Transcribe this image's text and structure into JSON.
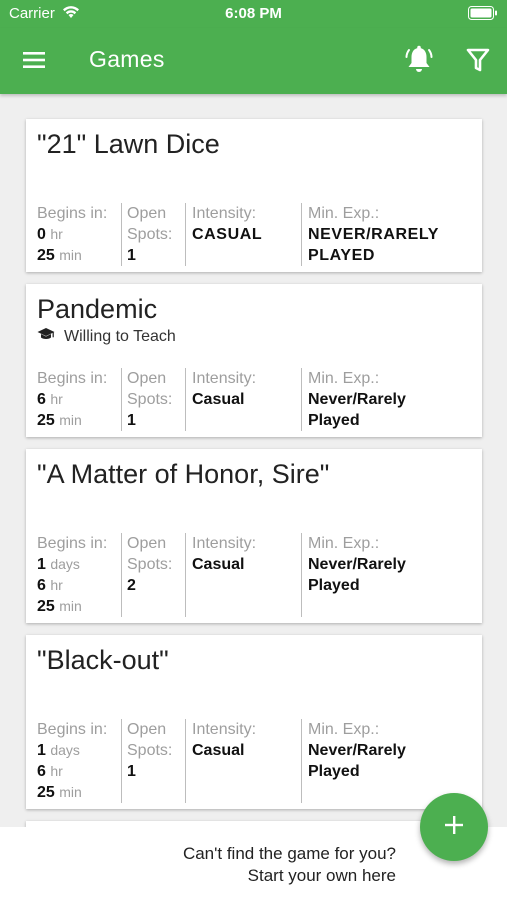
{
  "status_bar": {
    "carrier": "Carrier",
    "time": "6:08 PM"
  },
  "app_bar": {
    "title": "Games"
  },
  "games": [
    {
      "title": "\"21\" Lawn Dice",
      "teach_label": "",
      "begins_label": "Begins in:",
      "begins": [
        {
          "value": "0",
          "unit": "hr"
        },
        {
          "value": "25",
          "unit": "min"
        }
      ],
      "spots_label_1": "Open",
      "spots_label_2": "Spots:",
      "open_spots": "1",
      "intensity_label": "Intensity:",
      "intensity": "CASUAL",
      "exp_label": "Min. Exp.:",
      "exp_line1": "NEVER/RARELY",
      "exp_line2": "PLAYED"
    },
    {
      "title": "Pandemic",
      "teach_label": "Willing to Teach",
      "begins_label": "Begins in:",
      "begins": [
        {
          "value": "6",
          "unit": "hr"
        },
        {
          "value": "25",
          "unit": "min"
        }
      ],
      "spots_label_1": "Open",
      "spots_label_2": "Spots:",
      "open_spots": "1",
      "intensity_label": "Intensity:",
      "intensity": "Casual",
      "exp_label": "Min. Exp.:",
      "exp_line1": "Never/Rarely",
      "exp_line2": "Played"
    },
    {
      "title": "\"A Matter of Honor, Sire\"",
      "teach_label": "",
      "begins_label": "Begins in:",
      "begins": [
        {
          "value": "1",
          "unit": "days"
        },
        {
          "value": "6",
          "unit": "hr"
        },
        {
          "value": "25",
          "unit": "min"
        }
      ],
      "spots_label_1": "Open",
      "spots_label_2": "Spots:",
      "open_spots": "2",
      "intensity_label": "Intensity:",
      "intensity": "Casual",
      "exp_label": "Min. Exp.:",
      "exp_line1": "Never/Rarely",
      "exp_line2": "Played"
    },
    {
      "title": "\"Black-out\"",
      "teach_label": "",
      "begins_label": "Begins in:",
      "begins": [
        {
          "value": "1",
          "unit": "days"
        },
        {
          "value": "6",
          "unit": "hr"
        },
        {
          "value": "25",
          "unit": "min"
        }
      ],
      "spots_label_1": "Open",
      "spots_label_2": "Spots:",
      "open_spots": "1",
      "intensity_label": "Intensity:",
      "intensity": "Casual",
      "exp_label": "Min. Exp.:",
      "exp_line1": "Never/Rarely",
      "exp_line2": "Played"
    }
  ],
  "bottom_bar": {
    "line1": "Can't find the game for you?",
    "line2": "Start your own here"
  },
  "colors": {
    "accent": "#4caf50",
    "background": "#efefef",
    "label_gray": "#9e9e9e"
  },
  "icons": {
    "menu": "hamburger-icon",
    "bell": "bell-icon",
    "filter": "filter-icon",
    "teach": "graduation-cap-icon",
    "fab": "plus-icon"
  }
}
